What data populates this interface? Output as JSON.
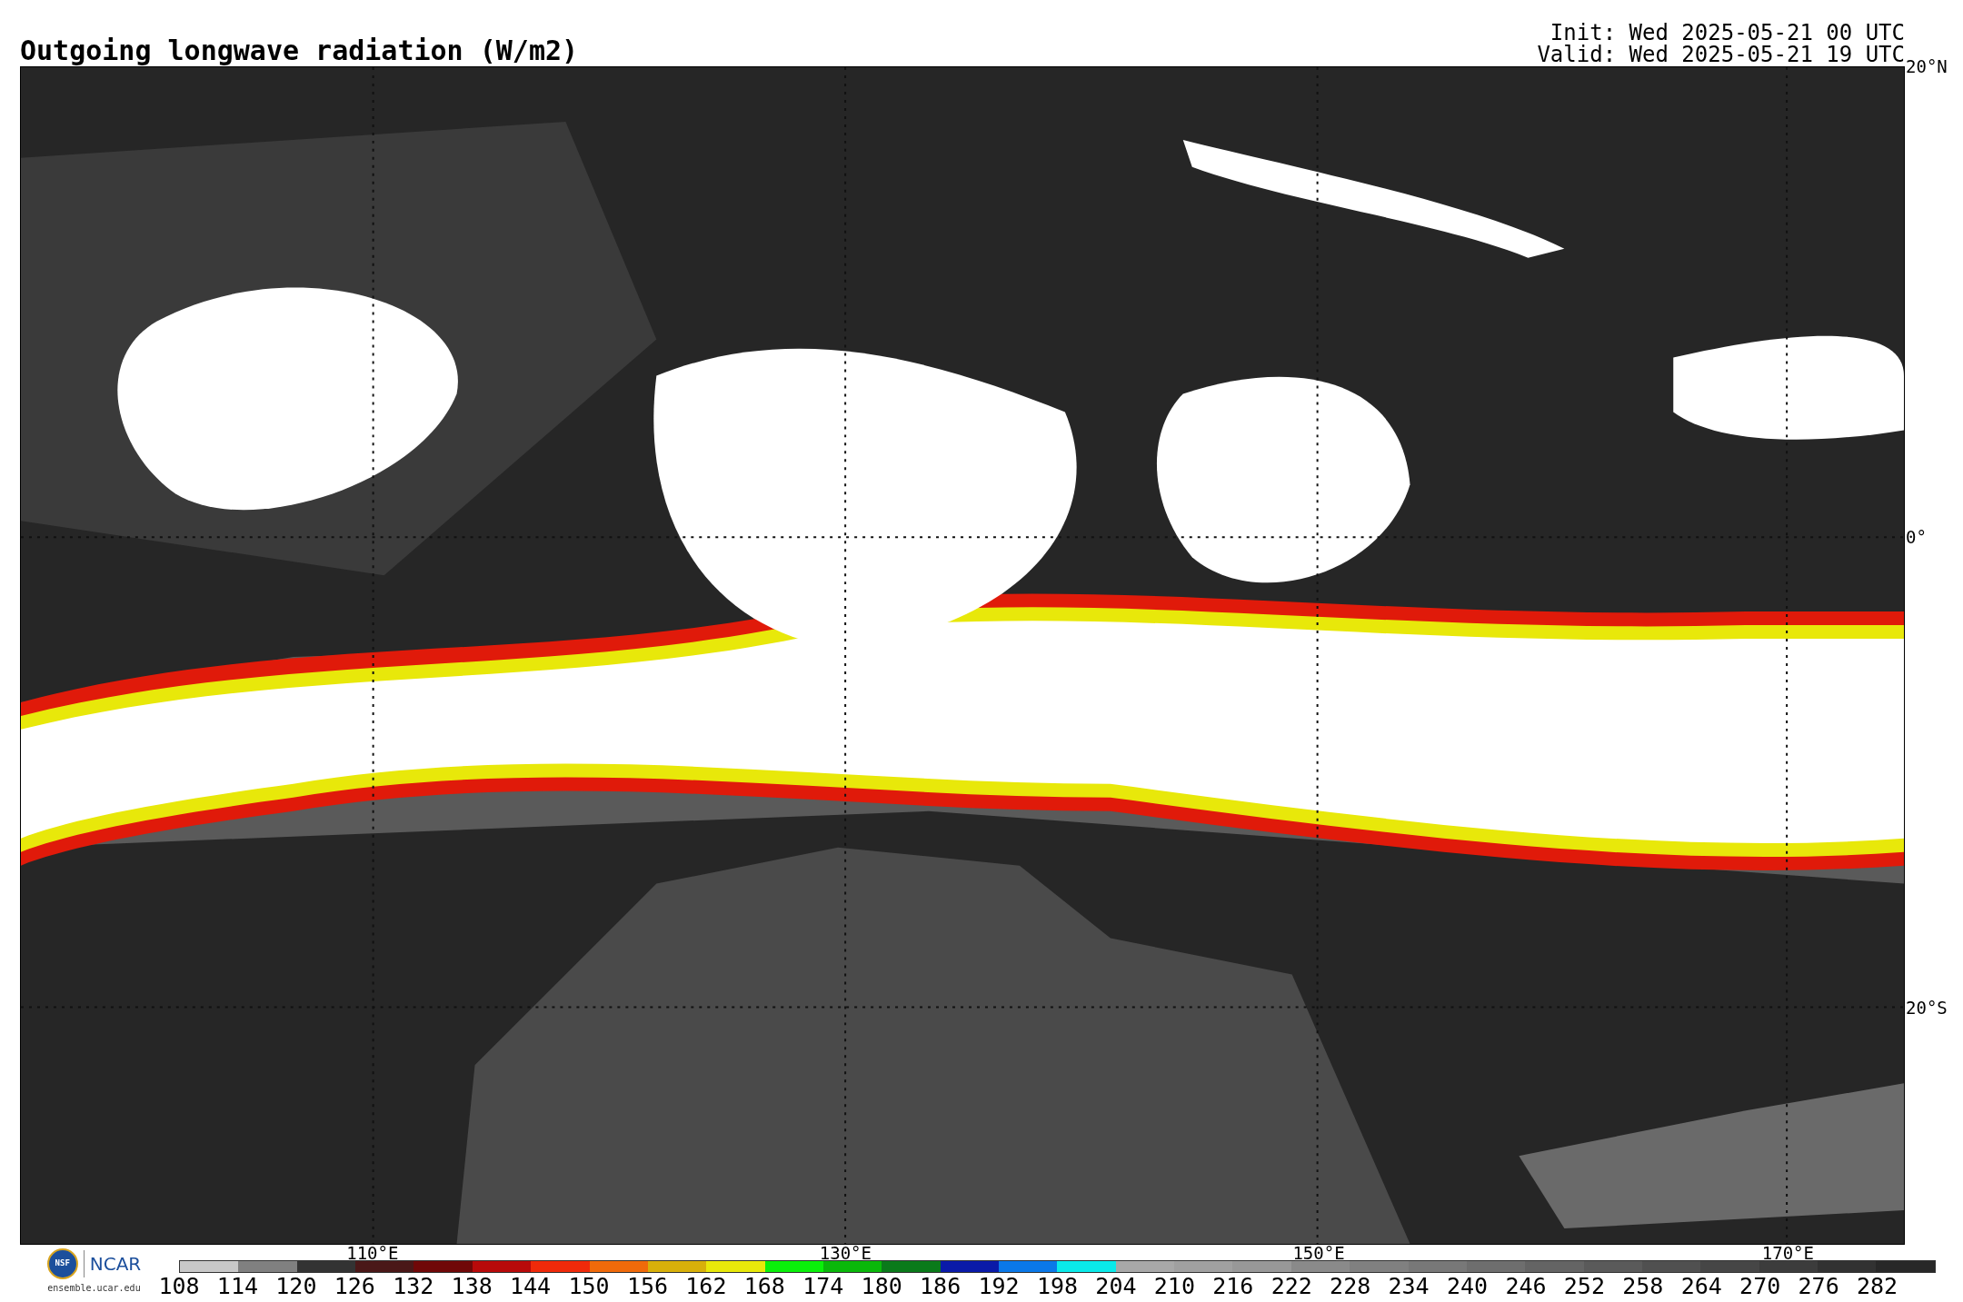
{
  "title": "Outgoing longwave radiation (W/m2)",
  "run_info": [
    "Init: Wed 2025-05-21 00 UTC",
    "Valid: Wed 2025-05-21 19 UTC"
  ],
  "lat_labels": [
    "20°N",
    "0°",
    "20°S"
  ],
  "lon_labels": [
    "110°E",
    "130°E",
    "150°E",
    "170°E"
  ],
  "logo": {
    "nsf": "NSF",
    "ncar": "NCAR",
    "url": "ensemble.ucar.edu"
  },
  "colorbar": [
    {
      "label": "108",
      "color": "#c8c8c8"
    },
    {
      "label": "114",
      "color": "#808080"
    },
    {
      "label": "120",
      "color": "#333333"
    },
    {
      "label": "126",
      "color": "#4a1818"
    },
    {
      "label": "132",
      "color": "#700808"
    },
    {
      "label": "138",
      "color": "#b80a0a"
    },
    {
      "label": "144",
      "color": "#f02a0a"
    },
    {
      "label": "150",
      "color": "#f06a0a"
    },
    {
      "label": "156",
      "color": "#d8b00a"
    },
    {
      "label": "162",
      "color": "#e8e80a"
    },
    {
      "label": "168",
      "color": "#0af00a"
    },
    {
      "label": "174",
      "color": "#0ab80a"
    },
    {
      "label": "180",
      "color": "#0a7a1a"
    },
    {
      "label": "186",
      "color": "#0a1aa8"
    },
    {
      "label": "192",
      "color": "#0a78e8"
    },
    {
      "label": "198",
      "color": "#0aeaea"
    },
    {
      "label": "204",
      "color": "#a8a8a8"
    },
    {
      "label": "210",
      "color": "#a0a0a0"
    },
    {
      "label": "216",
      "color": "#989898"
    },
    {
      "label": "222",
      "color": "#8a8a8a"
    },
    {
      "label": "228",
      "color": "#808080"
    },
    {
      "label": "234",
      "color": "#787878"
    },
    {
      "label": "240",
      "color": "#6e6e6e"
    },
    {
      "label": "246",
      "color": "#646464"
    },
    {
      "label": "252",
      "color": "#5a5a5a"
    },
    {
      "label": "258",
      "color": "#505050"
    },
    {
      "label": "264",
      "color": "#464646"
    },
    {
      "label": "270",
      "color": "#3c3c3c"
    },
    {
      "label": "276",
      "color": "#323232"
    },
    {
      "label": "282",
      "color": "#282828"
    }
  ]
}
